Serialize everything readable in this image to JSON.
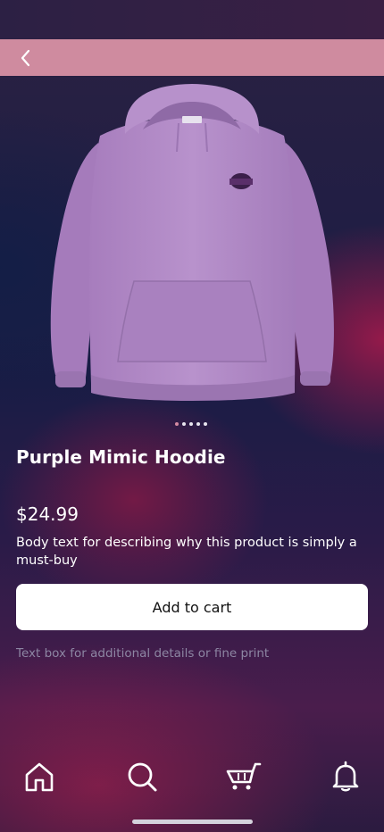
{
  "product": {
    "title": "Purple Mimic Hoodie",
    "price": "$24.99",
    "description": "Body text for describing why this product is simply a must-buy",
    "fine_print": "Text box for additional details or fine print",
    "logo_text": "MIMIC",
    "image_count": 5,
    "active_image_index": 0
  },
  "actions": {
    "add_to_cart_label": "Add to cart"
  },
  "nav": {
    "back_icon": "chevron-left-icon"
  },
  "tabs": [
    {
      "name": "home",
      "icon": "home-icon"
    },
    {
      "name": "search",
      "icon": "search-icon"
    },
    {
      "name": "cart",
      "icon": "cart-icon"
    },
    {
      "name": "notifications",
      "icon": "bell-icon"
    }
  ],
  "colors": {
    "nav_bar": "#cf8b9f",
    "hoodie": "#b48cc8",
    "button_background": "#ffffff",
    "fine_print": "#8d86a3"
  }
}
